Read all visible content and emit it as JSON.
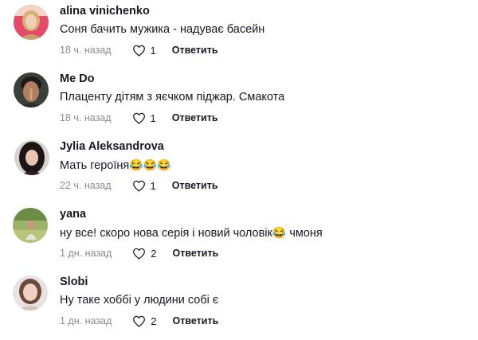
{
  "comments": [
    {
      "avatar": "avatar-blonde-woman",
      "username": "alina vinichenko",
      "text": "Соня бачить мужика - надуває басейн",
      "emoji": "",
      "text_after": "",
      "time": "18 ч. назад",
      "likes": "1",
      "reply_label": "Ответить"
    },
    {
      "avatar": "avatar-man-finger-on-lips",
      "username": "Me Do",
      "text": "Плаценту дітям з яєчком піджар. Смакота",
      "emoji": "",
      "text_after": "",
      "time": "18 ч. назад",
      "likes": "1",
      "reply_label": "Ответить"
    },
    {
      "avatar": "avatar-dark-hair-woman",
      "username": "Jylia Aleksandrova",
      "text": "Мать героїня",
      "emoji": "😂😂😂",
      "text_after": "",
      "time": "22 ч. назад",
      "likes": "1",
      "reply_label": "Ответить"
    },
    {
      "avatar": "avatar-woman-in-field",
      "username": "yana",
      "text": "ну все! скоро нова серія і новий чоловік",
      "emoji": "😂",
      "text_after": " чмоня",
      "time": "1 дн. назад",
      "likes": "2",
      "reply_label": "Ответить"
    },
    {
      "avatar": "avatar-woman-portrait",
      "username": "Slobi",
      "text": "Ну таке хоббі у людини собі є",
      "emoji": "",
      "text_after": "",
      "time": "1 дн. назад",
      "likes": "2",
      "reply_label": "Ответить"
    }
  ],
  "colors": {
    "text": "#161823",
    "meta": "#8a8b91"
  },
  "icons": {
    "like": "heart-outline-icon"
  }
}
